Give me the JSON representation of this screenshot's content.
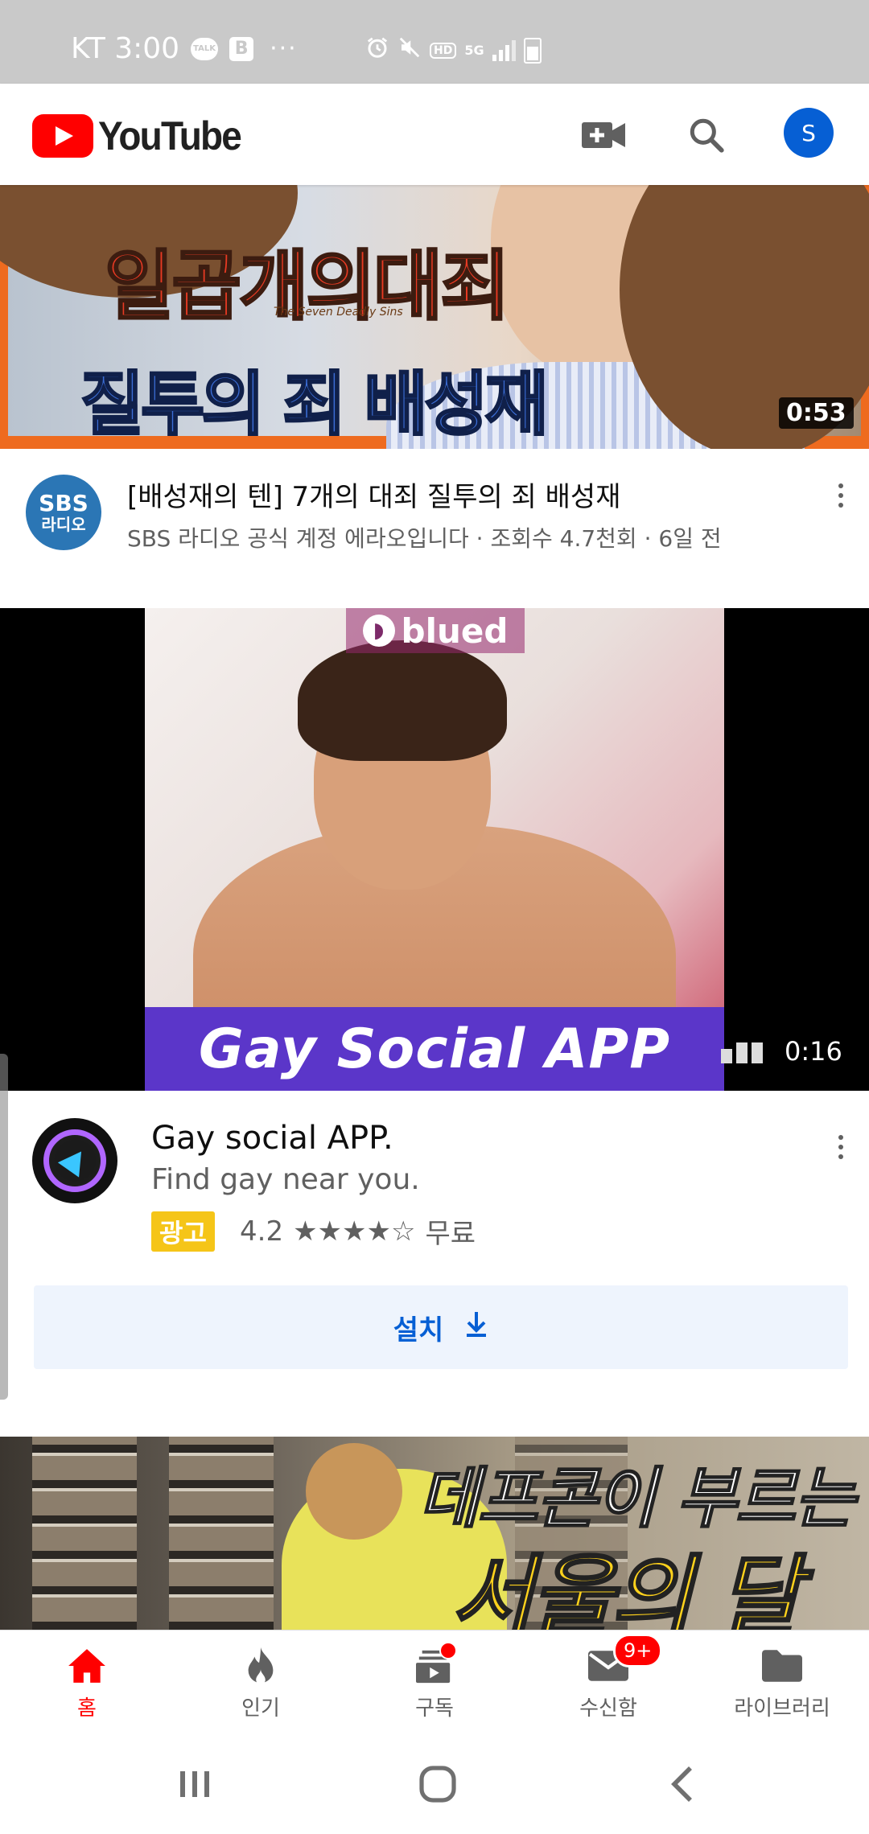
{
  "status_bar": {
    "carrier_time": "KT 3:00",
    "talk_icon_text": "TALK",
    "b_icon_text": "B",
    "more": "···",
    "hd": "HD",
    "network": "5G"
  },
  "app_bar": {
    "logo_text": "YouTube",
    "account_initial": "S",
    "icons": [
      "video-camera-add-icon",
      "search-icon",
      "account-avatar"
    ]
  },
  "video1": {
    "thumb_title_line1": "일곱개의대죄",
    "thumb_subtitle": "The Seven Deadly Sins",
    "thumb_title_line2": "질투의 죄 배성재",
    "duration": "0:53",
    "channel_avatar_text_top": "SBS",
    "channel_avatar_text_bottom": "라디오",
    "title": "[배성재의 텐] 7개의 대죄 질투의 죄 배성재",
    "subtitle": "SBS 라디오 공식 계정 에라오입니다 · 조회수 4.7천회 · 6일 전"
  },
  "ad": {
    "brand_text": "blued",
    "banner_text": "Gay Social APP",
    "duration": "0:16",
    "app_name": "Gay social APP.",
    "tagline": "Find gay near you.",
    "badge": "광고",
    "rating": "4.2",
    "stars": "★★★★☆",
    "price": "무료",
    "install_label": "설치"
  },
  "video3": {
    "thumb_line1": "데프콘이 부르는",
    "thumb_line2": "서울의 달"
  },
  "bottom_nav": {
    "items": [
      {
        "label": "홈",
        "icon": "home-icon",
        "active": true
      },
      {
        "label": "인기",
        "icon": "trending-fire-icon",
        "active": false
      },
      {
        "label": "구독",
        "icon": "subscriptions-icon",
        "active": false
      },
      {
        "label": "수신함",
        "icon": "inbox-mail-icon",
        "active": false
      },
      {
        "label": "라이브러리",
        "icon": "library-folder-icon",
        "active": false
      }
    ],
    "inbox_badge": "9+"
  },
  "colors": {
    "youtube_red": "#ff0000",
    "link_blue": "#065fd4",
    "ad_badge_yellow": "#f5c518",
    "thumb_border_orange": "#ee6b1f"
  }
}
